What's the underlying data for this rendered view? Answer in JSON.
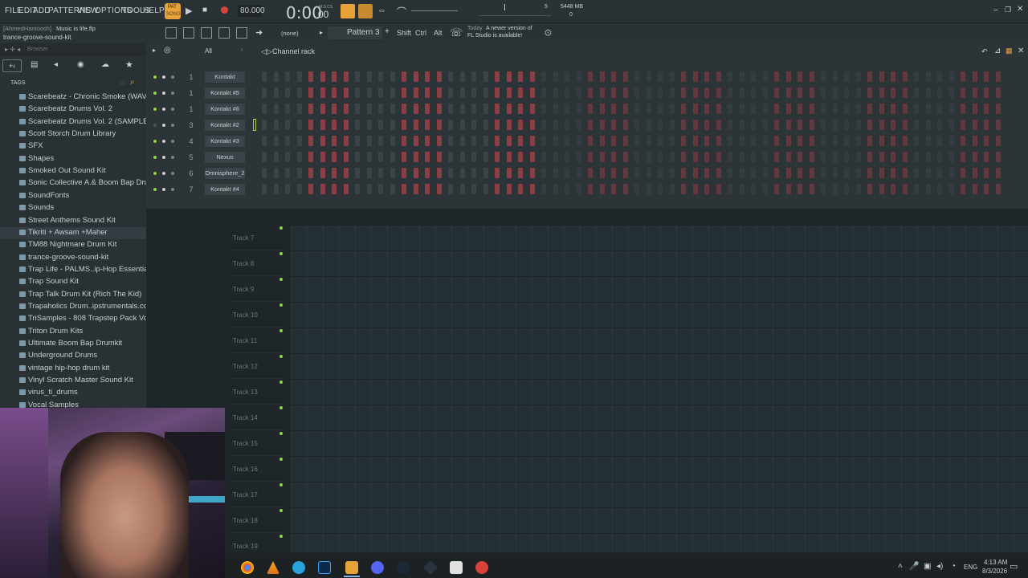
{
  "menu": [
    "FILE",
    "EDIT",
    "ADD",
    "PATTERNS",
    "VIEW",
    "OPTIONS",
    "TOOLS",
    "HELP"
  ],
  "transport": {
    "tempo": "80.000",
    "time": "0:00",
    "time_sub": "00",
    "time_unit": "M:S:CS",
    "pat_label": "PAT",
    "song_label": "SONG"
  },
  "memory": {
    "value": "5448 MB",
    "counter": "5",
    "voices": "0"
  },
  "project": {
    "user": "[AhmedHantoosh]",
    "file": "Music is life.flp",
    "current": "trance-groove-sound-kit"
  },
  "toolbar2": {
    "pattern": "Pattern 3",
    "none_label": "(none)",
    "keys": [
      "Shift",
      "Ctrl",
      "Alt"
    ],
    "news_date": "Today",
    "news_text_1": "A newer version of",
    "news_text_2": "FL Studio is available!"
  },
  "browser": {
    "title": "Browser",
    "tags_label": "TAGS",
    "items": [
      "Scarebeatz - Chronic Smoke (WAV)",
      "Scarebeatz Drums Vol. 2",
      "Scarebeatz Drums Vol. 2 (SAMPLER)",
      "Scott Storch Drum Library",
      "SFX",
      "Shapes",
      "Smoked Out Sound Kit",
      "Sonic Collective A.& Boom Bap Drums",
      "SoundFonts",
      "Sounds",
      "Street Anthems Sound Kit",
      "Tikriti + Awsam +Maher",
      "TM88 Nightmare Drum Kit",
      "trance-groove-sound-kit",
      "Trap Life - PALMS..ip-Hop Essentials 1",
      "Trap Sound Kit",
      "Trap Talk Drum Kit (Rich The Kid)",
      "Trapaholics Drum..ipstrumentals.com)",
      "TriSamples - 808 Trapstep Pack Vol 1",
      "Triton Drum Kits",
      "Ultimate Boom Bap Drumkit",
      "Underground Drums",
      "vintage hip-hop drum kit",
      "Vinyl Scratch Master Sound Kit",
      "virus_ti_drums",
      "Vocal Samples"
    ],
    "highlighted_index": 11
  },
  "channel_rack": {
    "title": "Channel rack",
    "filter": "All",
    "channels": [
      {
        "num": "1",
        "name": "Kontakt"
      },
      {
        "num": "1",
        "name": "Kontakt #5"
      },
      {
        "num": "1",
        "name": "Kontakt #6"
      },
      {
        "num": "3",
        "name": "Kontakt #2"
      },
      {
        "num": "4",
        "name": "Kontakt #3"
      },
      {
        "num": "5",
        "name": "Nexus"
      },
      {
        "num": "6",
        "name": "Omnisphere_2"
      },
      {
        "num": "7",
        "name": "Kontakt #4"
      }
    ]
  },
  "playlist": {
    "tracks": [
      "Track 7",
      "Track 8",
      "Track 9",
      "Track 10",
      "Track 11",
      "Track 12",
      "Track 13",
      "Track 14",
      "Track 15",
      "Track 16",
      "Track 17",
      "Track 18",
      "Track 19"
    ]
  },
  "taskbar": {
    "lang": "ENG",
    "time": "4:13 AM",
    "date": "8/3/2026"
  },
  "colors": {
    "accent_orange": "#e8a23a",
    "step_red": "#8e3d44",
    "step_dark": "#3a4347",
    "led_green": "#8fd14a"
  }
}
